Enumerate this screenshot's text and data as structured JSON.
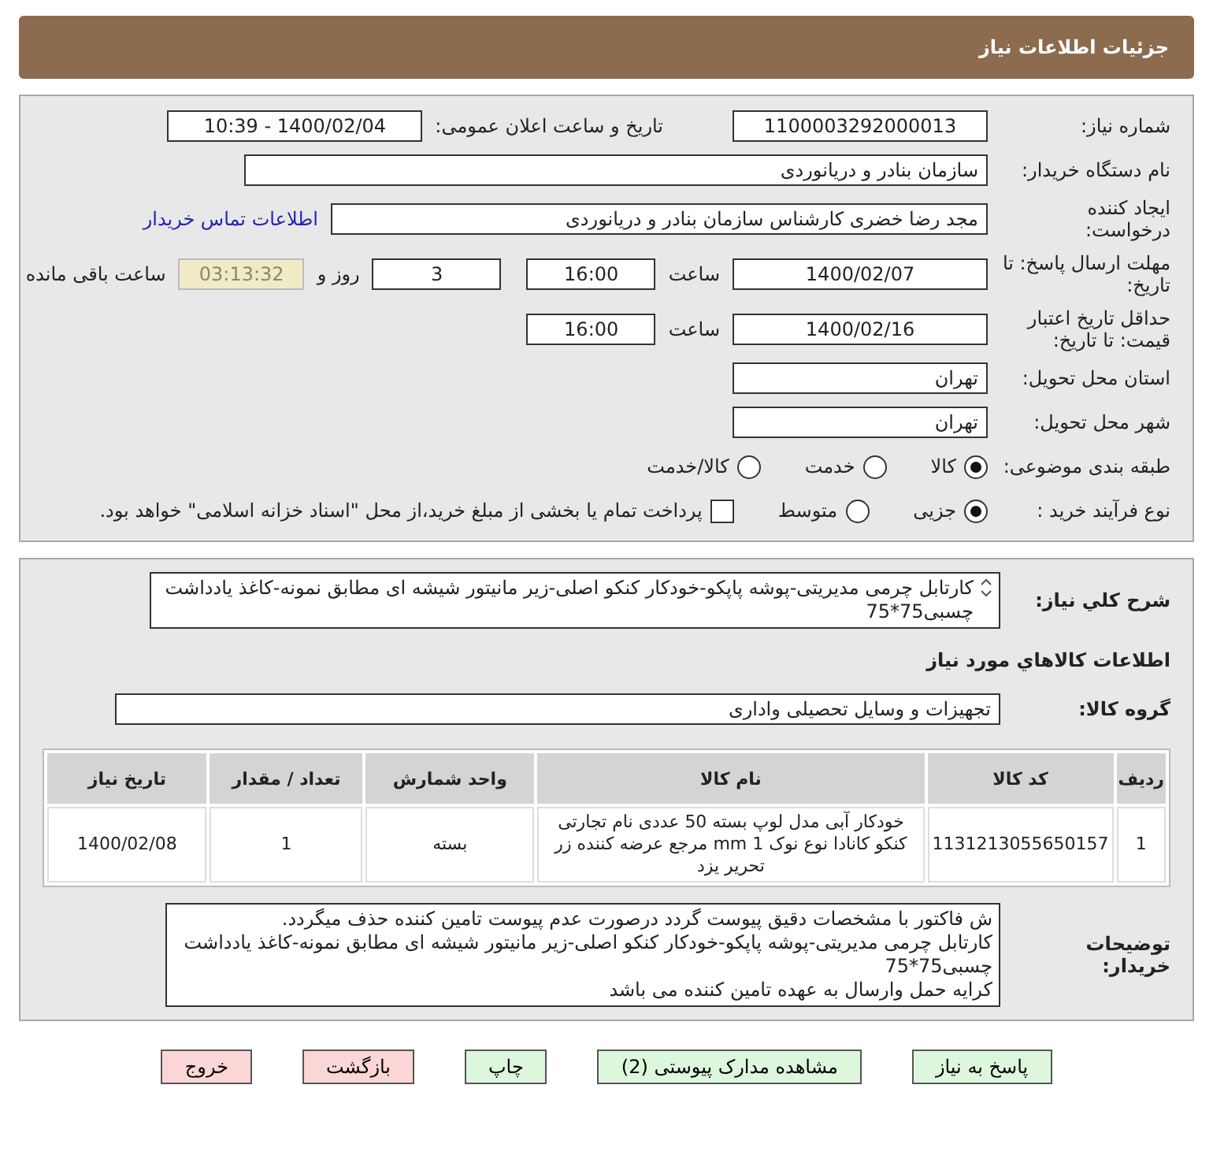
{
  "header": {
    "title": "جزئیات اطلاعات نیاز"
  },
  "info": {
    "need_number": {
      "label": "شماره نیاز:",
      "value": "1100003292000013"
    },
    "announce": {
      "label": "تاریخ و ساعت اعلان عمومی:",
      "value": "1400/02/04 - 10:39"
    },
    "buyer": {
      "label": "نام دستگاه خریدار:",
      "value": "سازمان بنادر و دریانوردی"
    },
    "creator": {
      "label": "ایجاد کننده درخواست:",
      "value": "مجد رضا خضری کارشناس سازمان بنادر و دریانوردی",
      "link": "اطلاعات تماس خریدار"
    },
    "deadline": {
      "label": "مهلت ارسال پاسخ: تا تاریخ:",
      "date": "1400/02/07",
      "time_label": "ساعت",
      "time": "16:00",
      "days": "3",
      "days_label": "روز و",
      "remaining": "03:13:32",
      "remaining_label": "ساعت باقی مانده"
    },
    "validity": {
      "label": "حداقل تاریخ اعتبار قیمت: تا تاریخ:",
      "date": "1400/02/16",
      "time_label": "ساعت",
      "time": "16:00"
    },
    "province": {
      "label": "استان محل تحویل:",
      "value": "تهران"
    },
    "city": {
      "label": "شهر محل تحویل:",
      "value": "تهران"
    },
    "category": {
      "label": "طبقه بندی موضوعی:",
      "options": [
        {
          "label": "کالا",
          "selected": true
        },
        {
          "label": "خدمت",
          "selected": false
        },
        {
          "label": "کالا/خدمت",
          "selected": false
        }
      ]
    },
    "process": {
      "label": "نوع فرآیند خرید :",
      "options": [
        {
          "label": "جزیی",
          "selected": true
        },
        {
          "label": "متوسط",
          "selected": false
        }
      ],
      "payment": {
        "label": "پرداخت تمام یا بخشی از مبلغ خرید،از محل \"اسناد خزانه اسلامی\" خواهد بود.",
        "checked": false
      }
    }
  },
  "details": {
    "summary": {
      "label": "شرح کلي نياز:",
      "value": "کارتابل چرمی مدیریتی-پوشه پاپکو-خودکار کنکو اصلی-زیر مانیتور شیشه ای مطابق نمونه-کاغذ یادداشت چسبی75*75"
    },
    "goods_title": "اطلاعات کالاهاي مورد نياز",
    "group": {
      "label": "گروه کالا:",
      "value": "تجهیزات و وسایل تحصیلی واداری"
    },
    "table": {
      "columns": [
        "ردیف",
        "کد کالا",
        "نام کالا",
        "واحد شمارش",
        "تعداد / مقدار",
        "تاریخ نیاز"
      ],
      "rows": [
        [
          "1",
          "1131213055650157",
          "خودکار آبی مدل لوپ بسته 50 عددی نام تجارتی کنکو کانادا نوع نوک 1 mm مرجع عرضه کننده زر تحریر یزد",
          "بسته",
          "1",
          "1400/02/08"
        ]
      ]
    },
    "notes": {
      "label": "توضیحات خریدار:",
      "lines": [
        "ش فاکتور با مشخصات دقیق پیوست گردد درصورت عدم پیوست تامین کننده حذف میگردد.",
        "کارتابل چرمی مدیریتی-پوشه پاپکو-خودکار کنکو اصلی-زیر مانیتور شیشه ای مطابق نمونه-کاغذ یادداشت چسبی75*75",
        "کرایه حمل وارسال به عهده تامین کننده می باشد"
      ]
    }
  },
  "buttons": [
    {
      "label": "پاسخ به نیاز",
      "kind": "normal"
    },
    {
      "label": "مشاهده مدارک پیوستی (2)",
      "kind": "normal"
    },
    {
      "label": "چاپ",
      "kind": "normal"
    },
    {
      "label": "بازگشت",
      "kind": "danger"
    },
    {
      "label": "خروج",
      "kind": "danger"
    }
  ]
}
